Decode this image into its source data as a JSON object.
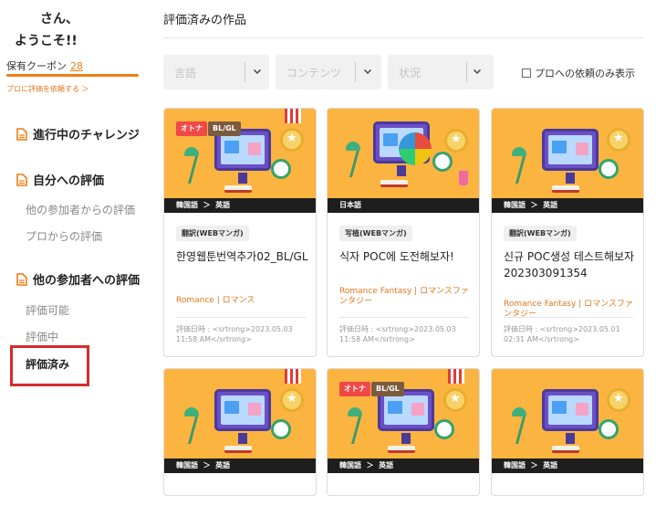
{
  "sidebar": {
    "greeting_line1": "さん、",
    "greeting_line2": "ようこそ!!",
    "coupon_label": "保有クーポン",
    "coupon_count": "28",
    "pro_link": "プロに評価を依頼する ＞",
    "sections": [
      {
        "title": "進行中のチャレンジ",
        "items": []
      },
      {
        "title": "自分への評価",
        "items": [
          "他の参加者からの評価",
          "プロからの評価"
        ]
      },
      {
        "title": "他の参加者への評価",
        "items": [
          "評価可能",
          "評価中",
          "評価済み"
        ]
      }
    ],
    "active_item": "評価済み"
  },
  "main": {
    "title": "評価済みの作品",
    "filters": [
      {
        "placeholder": "言語"
      },
      {
        "placeholder": "コンテンツ"
      },
      {
        "placeholder": "状況"
      }
    ],
    "pro_only_label": "プロへの依頼のみ表示",
    "cards": [
      {
        "badges": [
          "オトナ",
          "BL/GL"
        ],
        "lang_from": "韓国語",
        "lang_sep": "＞",
        "lang_to": "英語",
        "category": "翻訳(WEBマンガ)",
        "title": "한영웹툰번역추가02_BL/GL",
        "genre": "Romance | ロマンス",
        "date": "評価日時 : <srtrong>2023.05.03 11:58 AM</srtrong>"
      },
      {
        "badges": [],
        "lang_from": "日本語",
        "lang_sep": "",
        "lang_to": "",
        "category": "写植(WEBマンガ)",
        "title": "식자 POC에 도전해보자!",
        "genre": "Romance Fantasy | ロマンスファンタジー",
        "date": "評価日時 : <srtrong>2023.05.03 11:58 AM</srtrong>"
      },
      {
        "badges": [],
        "lang_from": "韓国語",
        "lang_sep": "＞",
        "lang_to": "英語",
        "category": "翻訳(WEBマンガ)",
        "title": "신규 POC생성 테스트해보자 20230309135​4",
        "genre": "Romance Fantasy | ロマンスファンタジー",
        "date": "評価日時 : <srtrong>2023.05.01 02:31 AM</srtrong>"
      },
      {
        "badges": [],
        "lang_from": "韓国語",
        "lang_sep": "＞",
        "lang_to": "英語"
      },
      {
        "badges": [
          "オトナ",
          "BL/GL"
        ],
        "lang_from": "韓国語",
        "lang_sep": "＞",
        "lang_to": "英語"
      },
      {
        "badges": [],
        "lang_from": "韓国語",
        "lang_sep": "＞",
        "lang_to": "英語"
      }
    ]
  },
  "colors": {
    "accent": "#f07d14",
    "thumb_bg": "#fbb440",
    "highlight_box": "#d92a2a"
  },
  "icons": [
    "document-icon",
    "chevron-down-icon",
    "checkbox-icon",
    "medal-icon",
    "ribbon-icon"
  ]
}
